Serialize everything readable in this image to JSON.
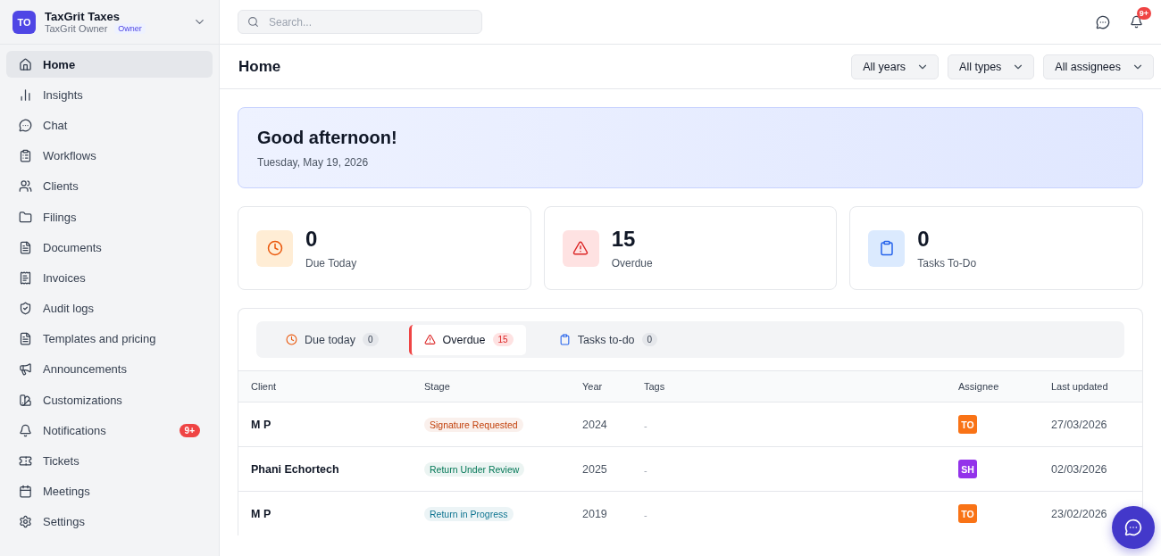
{
  "workspace": {
    "avatar": "TO",
    "name": "TaxGrit Taxes",
    "user": "TaxGrit Owner",
    "role": "Owner"
  },
  "sidebar": {
    "items": [
      {
        "label": "Home",
        "selected": true
      },
      {
        "label": "Insights",
        "selected": false
      },
      {
        "label": "Chat",
        "selected": false
      },
      {
        "label": "Workflows",
        "selected": false
      },
      {
        "label": "Clients",
        "selected": false
      },
      {
        "label": "Filings",
        "selected": false
      },
      {
        "label": "Documents",
        "selected": false
      },
      {
        "label": "Invoices",
        "selected": false
      },
      {
        "label": "Audit logs",
        "selected": false
      },
      {
        "label": "Templates and pricing",
        "selected": false
      },
      {
        "label": "Announcements",
        "selected": false
      },
      {
        "label": "Customizations",
        "selected": false
      },
      {
        "label": "Notifications",
        "selected": false,
        "badge": "9+"
      },
      {
        "label": "Tickets",
        "selected": false
      },
      {
        "label": "Meetings",
        "selected": false
      },
      {
        "label": "Settings",
        "selected": false
      }
    ]
  },
  "topbar": {
    "search_placeholder": "Search...",
    "notification_badge": "9+"
  },
  "page": {
    "title": "Home",
    "filters": [
      "All years",
      "All types",
      "All assignees"
    ]
  },
  "greeting": {
    "title": "Good afternoon!",
    "date": "Tuesday, May 19, 2026"
  },
  "stats": [
    {
      "kind": "due",
      "value": "0",
      "label": "Due Today"
    },
    {
      "kind": "overdue",
      "value": "15",
      "label": "Overdue"
    },
    {
      "kind": "tasks",
      "value": "0",
      "label": "Tasks To-Do"
    }
  ],
  "tabs": [
    {
      "kind": "due",
      "label": "Due today",
      "count": "0",
      "selected": false
    },
    {
      "kind": "overdue",
      "label": "Overdue",
      "count": "15",
      "selected": true
    },
    {
      "kind": "tasks",
      "label": "Tasks to-do",
      "count": "0",
      "selected": false
    }
  ],
  "table": {
    "columns": [
      "Client",
      "Stage",
      "Year",
      "Tags",
      "Assignee",
      "Last updated"
    ],
    "rows": [
      {
        "client": "M P",
        "stage": {
          "text": "Signature Requested",
          "color": "#c2410c"
        },
        "year": "2024",
        "tags": "-",
        "assignee": {
          "initials": "TO",
          "color": "#f97316"
        },
        "updated": "27/03/2026"
      },
      {
        "client": "Phani Echortech",
        "stage": {
          "text": "Return Under Review",
          "color": "#047857"
        },
        "year": "2025",
        "tags": "-",
        "assignee": {
          "initials": "SH",
          "color": "#9333ea"
        },
        "updated": "02/03/2026"
      },
      {
        "client": "M P",
        "stage": {
          "text": "Return in Progress",
          "color": "#0e7490"
        },
        "year": "2019",
        "tags": "-",
        "assignee": {
          "initials": "TO",
          "color": "#f97316"
        },
        "updated": "23/02/2026"
      }
    ]
  }
}
